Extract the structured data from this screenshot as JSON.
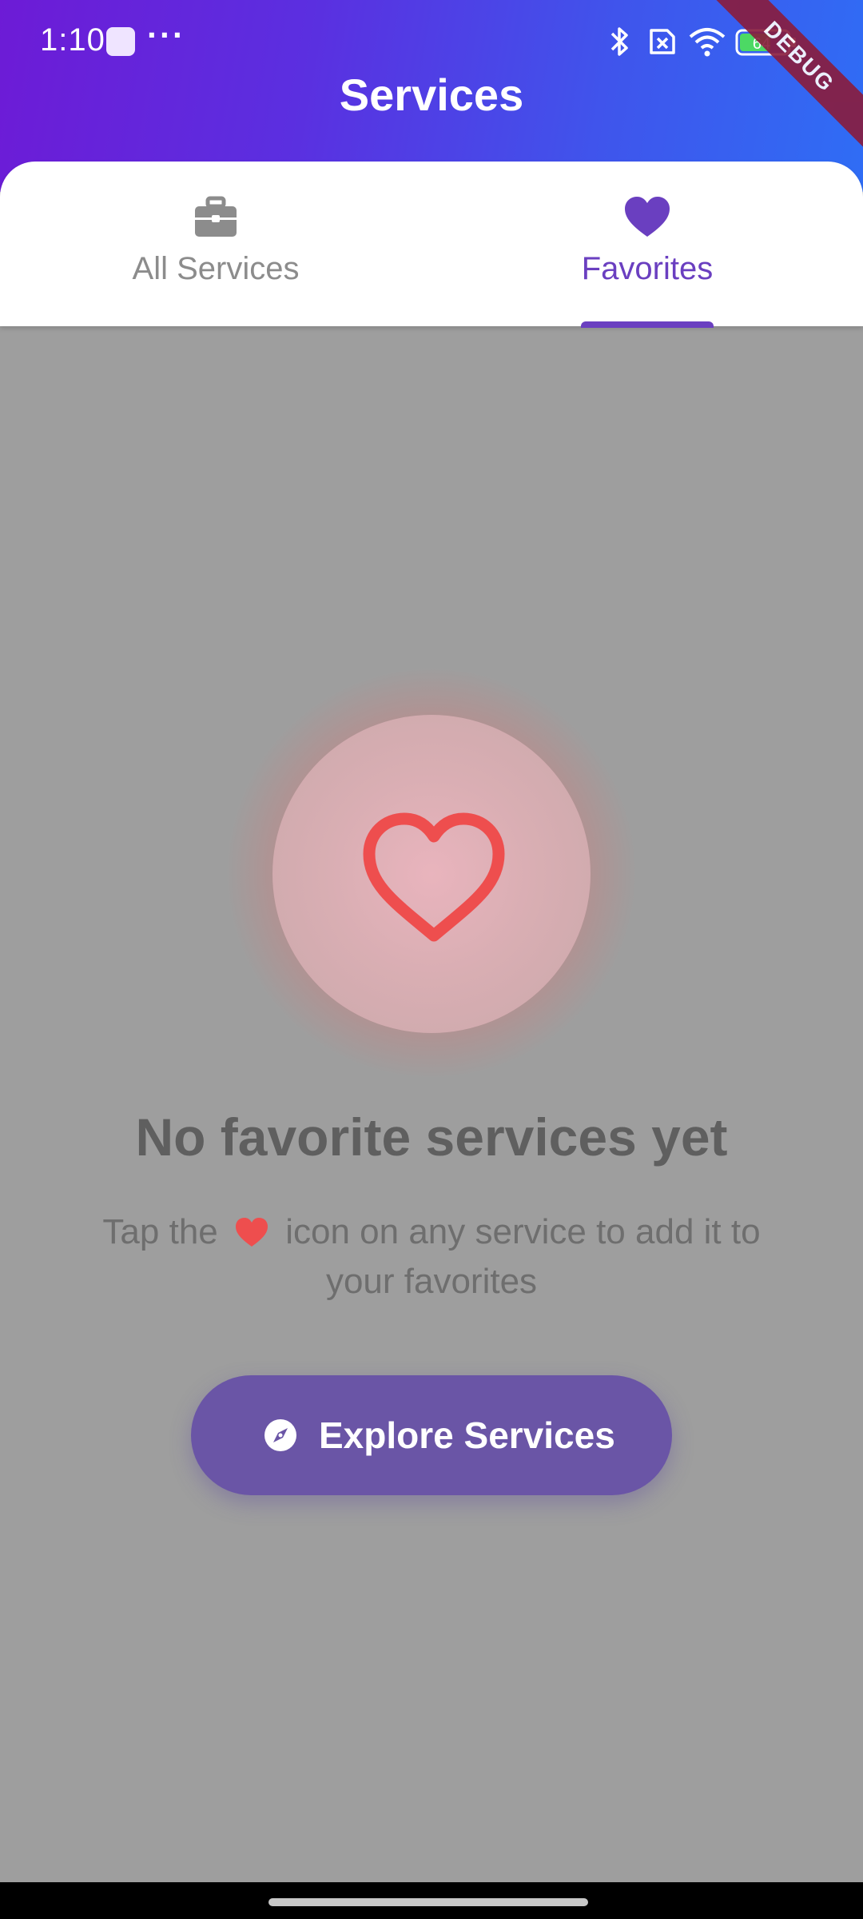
{
  "status_bar": {
    "time": "1:10",
    "dots": "···",
    "battery": "64"
  },
  "header": {
    "title": "Services",
    "debug_badge": "DEBUG",
    "gradient_start": "#6d1bd6",
    "gradient_end": "#2f6df5"
  },
  "tabs": [
    {
      "label": "All Services",
      "icon": "briefcase-icon",
      "selected": false
    },
    {
      "label": "Favorites",
      "icon": "heart-icon",
      "selected": true
    }
  ],
  "empty_state": {
    "title": "No favorite services yet",
    "subtitle_before": "Tap the",
    "subtitle_after": "icon on any service to add it to your favorites",
    "button_label": "Explore Services",
    "button_icon": "compass-icon",
    "accent_color": "#6a3fc0",
    "heart_color": "#ee4e4e"
  }
}
